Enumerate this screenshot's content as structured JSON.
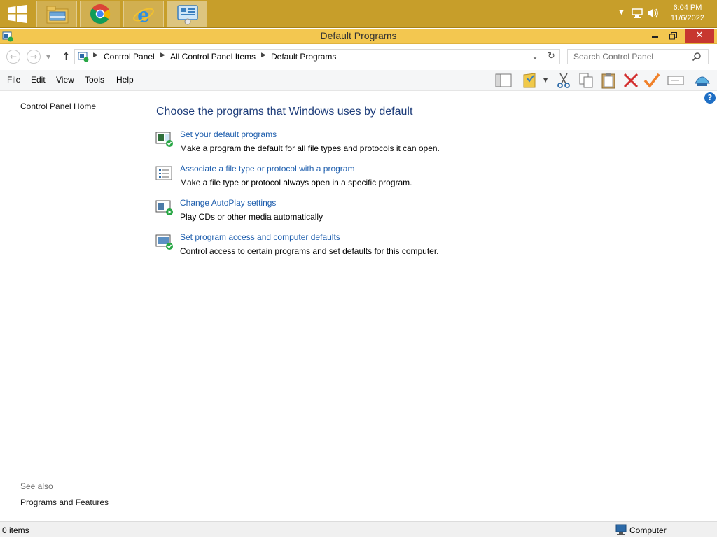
{
  "taskbar": {
    "apps": [
      {
        "name": "File Explorer",
        "icon": "file-explorer-icon"
      },
      {
        "name": "Google Chrome",
        "icon": "chrome-icon"
      },
      {
        "name": "Internet Explorer",
        "icon": "ie-icon"
      },
      {
        "name": "Control Panel",
        "icon": "control-panel-icon",
        "active": true
      }
    ],
    "clock_time": "6:04 PM",
    "clock_date": "11/6/2022"
  },
  "window": {
    "title": "Default Programs"
  },
  "address": {
    "crumbs": [
      "Control Panel",
      "All Control Panel Items",
      "Default Programs"
    ],
    "search_placeholder": "Search Control Panel"
  },
  "menu": {
    "file": "File",
    "edit": "Edit",
    "view": "View",
    "tools": "Tools",
    "help": "Help"
  },
  "left_pane": {
    "home": "Control Panel Home",
    "see_also": "See also",
    "programs_features": "Programs and Features"
  },
  "main": {
    "heading": "Choose the programs that Windows uses by default",
    "tasks": [
      {
        "link": "Set your default programs",
        "desc": "Make a program the default for all file types and protocols it can open.",
        "icon": "default-programs-icon"
      },
      {
        "link": "Associate a file type or protocol with a program",
        "desc": "Make a file type or protocol always open in a specific program.",
        "icon": "file-association-icon"
      },
      {
        "link": "Change AutoPlay settings",
        "desc": "Play CDs or other media automatically",
        "icon": "autoplay-icon"
      },
      {
        "link": "Set program access and computer defaults",
        "desc": "Control access to certain programs and set defaults for this computer.",
        "icon": "program-access-icon"
      }
    ]
  },
  "status": {
    "items": "0 items",
    "zone": "Computer"
  },
  "colors": {
    "taskbar": "#c79e2a",
    "titlebar": "#f3c750",
    "close_button": "#c7372f",
    "link": "#1f5fae",
    "heading": "#1e3d7a"
  }
}
